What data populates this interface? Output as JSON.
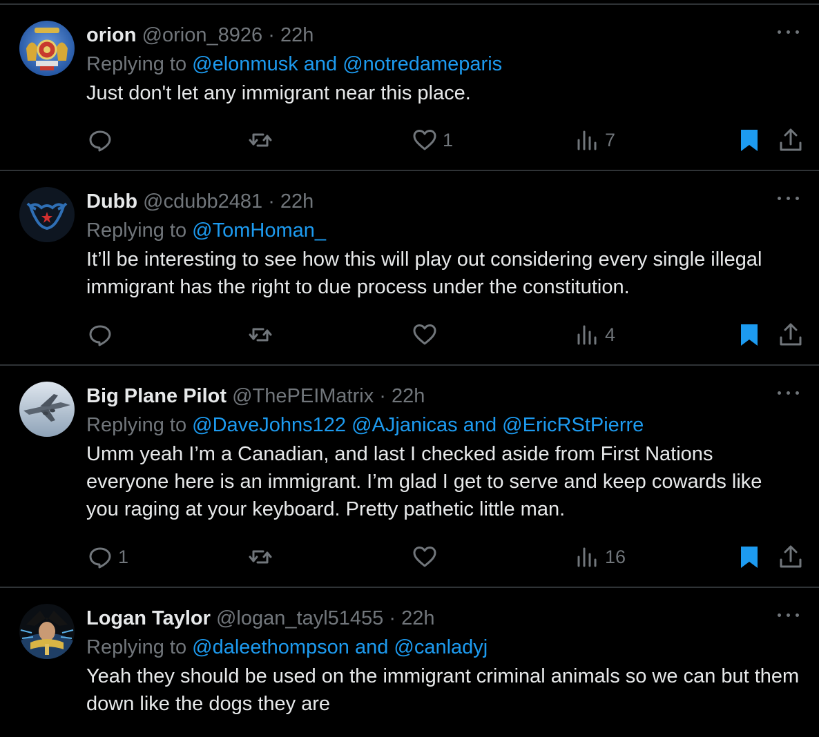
{
  "tweets": [
    {
      "name": "orion",
      "handle": "@orion_8926",
      "time": "22h",
      "replying_prefix": "Replying to",
      "mentions": "@elonmusk and @notredameparis",
      "text": "Just don't let any immigrant near this place.",
      "replies": "",
      "likes": "1",
      "views": "7",
      "bookmarked": true,
      "avatar_icon": "royal-crest-avatar"
    },
    {
      "name": "Dubb",
      "handle": "@cdubb2481",
      "time": "22h",
      "replying_prefix": "Replying to",
      "mentions": "@TomHoman_",
      "text": "It’ll be interesting to see how this will play out considering every single illegal immigrant has the right to due process under the constitution.",
      "replies": "",
      "likes": "",
      "views": "4",
      "bookmarked": true,
      "avatar_icon": "bull-logo-avatar"
    },
    {
      "name": "Big Plane Pilot",
      "handle": "@ThePEIMatrix",
      "time": "22h",
      "replying_prefix": "Replying to",
      "mentions": "@DaveJohns122 @AJjanicas and @EricRStPierre",
      "text": "Umm yeah I’m a Canadian, and last I checked aside from First Nations everyone here is an immigrant. I’m glad I get to serve and keep cowards like you raging at your keyboard. Pretty pathetic little man.",
      "replies": "1",
      "likes": "",
      "views": "16",
      "bookmarked": true,
      "avatar_icon": "airplane-avatar"
    },
    {
      "name": "Logan Taylor",
      "handle": "@logan_tayl51455",
      "time": "22h",
      "replying_prefix": "Replying to",
      "mentions": "@daleethompson and @canladyj",
      "text": "Yeah they should be used on the immigrant criminal animals so we can but them down like the dogs they are",
      "avatar_icon": "anime-character-avatar"
    }
  ],
  "separator": "·",
  "colors": {
    "background": "#000000",
    "text": "#e7e9ea",
    "muted": "#71767b",
    "accent": "#1d9bf0",
    "divider": "#2f3336"
  }
}
